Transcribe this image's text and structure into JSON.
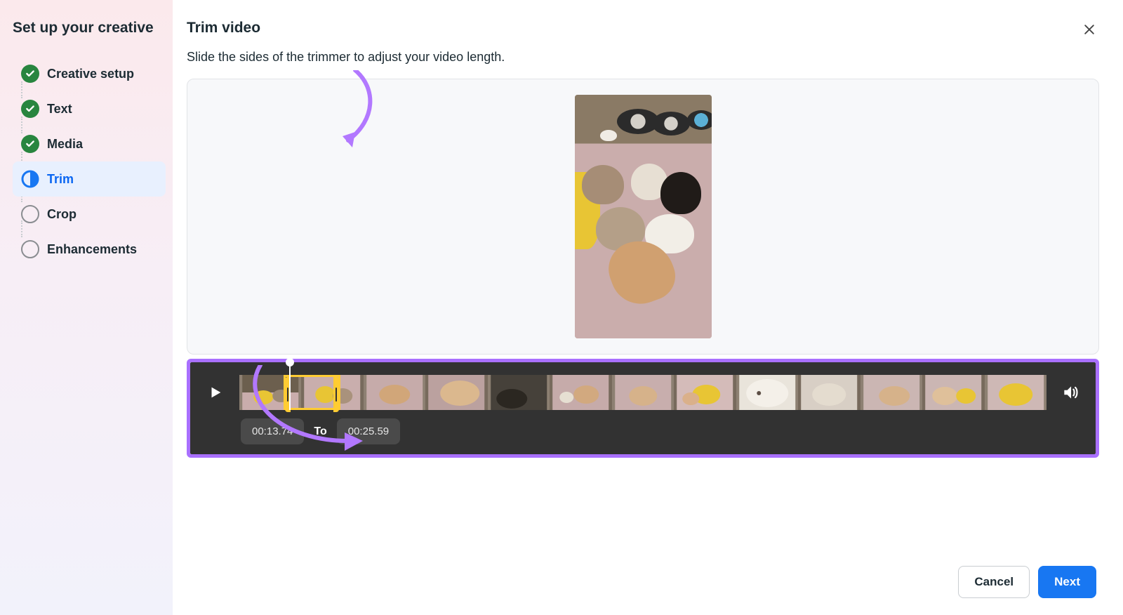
{
  "sidebar": {
    "title": "Set up your creative",
    "steps": [
      {
        "label": "Creative setup",
        "state": "done"
      },
      {
        "label": "Text",
        "state": "done"
      },
      {
        "label": "Media",
        "state": "done"
      },
      {
        "label": "Trim",
        "state": "current"
      },
      {
        "label": "Crop",
        "state": "pending"
      },
      {
        "label": "Enhancements",
        "state": "pending"
      }
    ]
  },
  "header": {
    "title": "Trim video",
    "description": "Slide the sides of the trimmer to adjust your video length."
  },
  "timeline": {
    "start_time": "00:13.74",
    "to_label": "To",
    "end_time": "00:25.59",
    "frame_count": 13
  },
  "footer": {
    "cancel_label": "Cancel",
    "next_label": "Next"
  },
  "icons": {
    "check": "check-icon",
    "half_progress": "half-circle-icon",
    "empty_circle": "empty-circle-icon",
    "close": "close-icon",
    "play": "play-icon",
    "volume": "volume-icon"
  }
}
